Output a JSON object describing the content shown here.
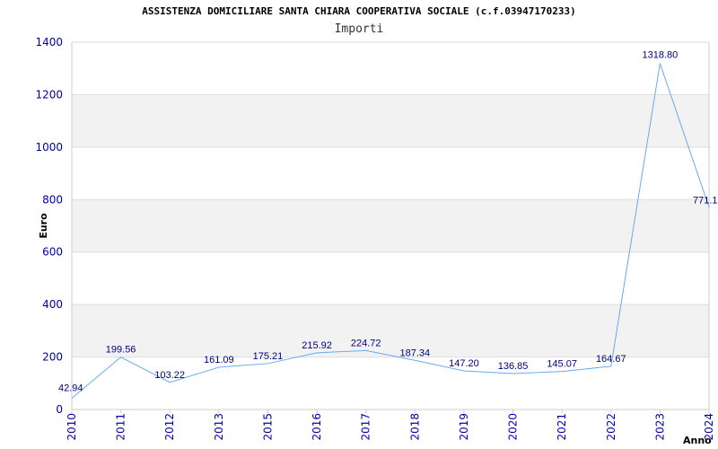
{
  "title": "ASSISTENZA DOMICILIARE SANTA CHIARA COOPERATIVA SOCIALE (c.f.03947170233)",
  "subtitle": "Importi",
  "colors": {
    "line": "#66aaee",
    "band": "#f2f2f2",
    "grid": "#dddddd",
    "tick_text": "#0000aa",
    "data_label_text": "#000080"
  },
  "chart_data": {
    "type": "line",
    "title": "ASSISTENZA DOMICILIARE SANTA CHIARA COOPERATIVA SOCIALE (c.f.03947170233)",
    "subtitle": "Importi",
    "xlabel": "Anno",
    "ylabel": "Euro",
    "ylim": [
      0,
      1400
    ],
    "yticks": [
      "0",
      "200",
      "400",
      "600",
      "800",
      "1000",
      "1200",
      "1400"
    ],
    "grid": true,
    "categories": [
      "2010",
      "2011",
      "2012",
      "2013",
      "2015",
      "2016",
      "2017",
      "2018",
      "2019",
      "2020",
      "2021",
      "2022",
      "2023",
      "2024"
    ],
    "values": [
      42.94,
      199.56,
      103.22,
      161.09,
      175.21,
      215.92,
      224.72,
      187.34,
      147.2,
      136.85,
      145.07,
      164.67,
      1318.8,
      771.1
    ],
    "labels": [
      "42.94",
      "199.56",
      "103.22",
      "161.09",
      "175.21",
      "215.92",
      "224.72",
      "187.34",
      "147.20",
      "136.85",
      "145.07",
      "164.67",
      "1318.80",
      "771.1"
    ]
  }
}
